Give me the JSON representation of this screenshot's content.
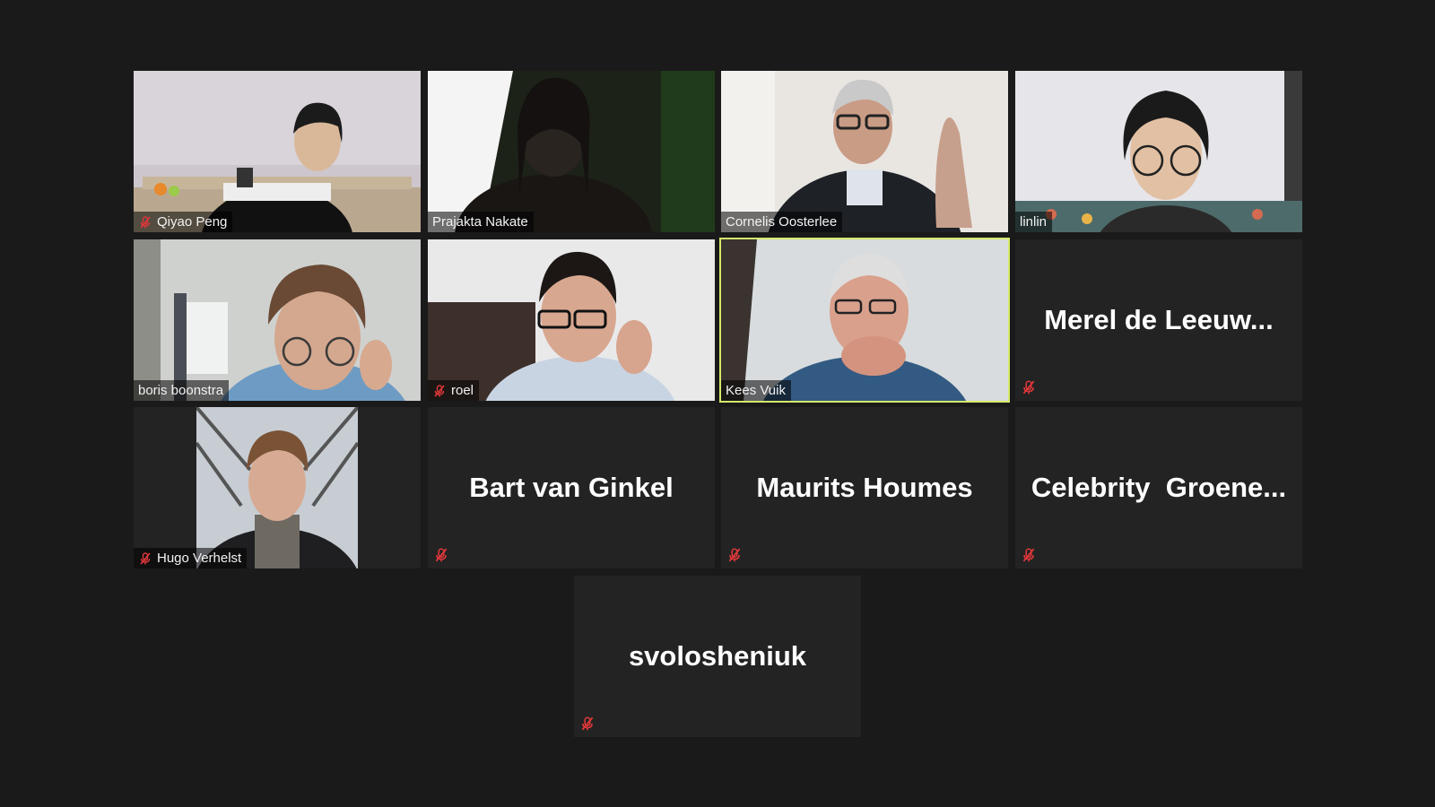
{
  "meeting": {
    "participants": [
      {
        "name": "Qiyao Peng",
        "muted": true,
        "video": true
      },
      {
        "name": "Prajakta Nakate",
        "muted": false,
        "video": true
      },
      {
        "name": "Cornelis Oosterlee",
        "muted": false,
        "video": true
      },
      {
        "name": "linlin",
        "muted": false,
        "video": true
      },
      {
        "name": "boris boonstra",
        "muted": false,
        "video": true
      },
      {
        "name": "roel",
        "muted": true,
        "video": true
      },
      {
        "name": "Kees Vuik",
        "muted": false,
        "video": true,
        "active_speaker": true
      },
      {
        "name": "Merel de Leeuw...",
        "muted": true,
        "video": false
      },
      {
        "name": "Hugo Verhelst",
        "muted": true,
        "video": true
      },
      {
        "name": "Bart van Ginkel",
        "muted": true,
        "video": false
      },
      {
        "name": "Maurits Houmes",
        "muted": true,
        "video": false
      },
      {
        "name": "Celebrity  Groene...",
        "muted": true,
        "video": false
      },
      {
        "name": "svolosheniuk",
        "muted": true,
        "video": false
      }
    ]
  },
  "colors": {
    "background": "#1a1a1a",
    "tile": "#232323",
    "active_border": "#d6e96a",
    "mute": "#e0373a"
  },
  "icons": {
    "muted": "mic-muted-icon"
  }
}
